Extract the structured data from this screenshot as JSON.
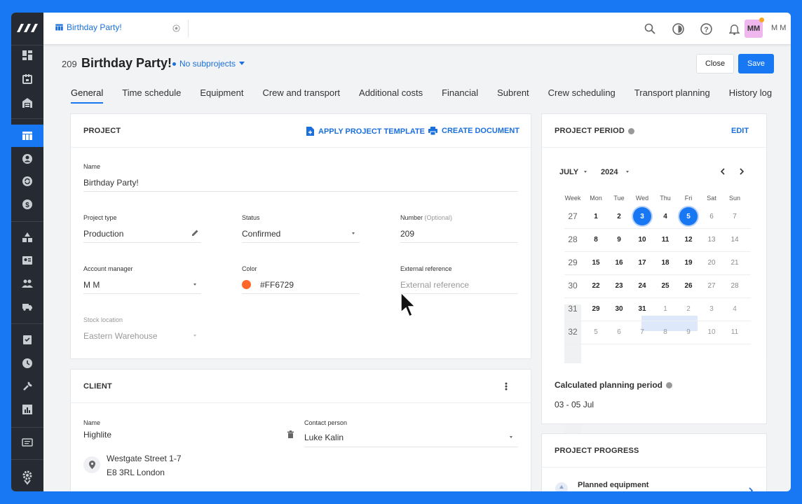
{
  "topbar": {
    "tab_title": "Birthday Party!",
    "user_initials": "MM",
    "user_name": "M M"
  },
  "header": {
    "project_number": "209",
    "project_title": "Birthday Party!",
    "subprojects_label": "No subprojects",
    "close_label": "Close",
    "save_label": "Save"
  },
  "tabs": [
    "General",
    "Time schedule",
    "Equipment",
    "Crew and transport",
    "Additional costs",
    "Financial",
    "Subrent",
    "Crew scheduling",
    "Transport planning",
    "History log"
  ],
  "project_card": {
    "title": "PROJECT",
    "apply_template": "APPLY PROJECT TEMPLATE",
    "create_document": "CREATE DOCUMENT",
    "name_label": "Name",
    "name_value": "Birthday Party!",
    "type_label": "Project type",
    "type_value": "Production",
    "status_label": "Status",
    "status_value": "Confirmed",
    "number_label": "Number",
    "number_optional": "(Optional)",
    "number_value": "209",
    "manager_label": "Account manager",
    "manager_value": "M M",
    "color_label": "Color",
    "color_value": "#FF6729",
    "extref_label": "External reference",
    "extref_placeholder": "External reference",
    "stock_label": "Stock location",
    "stock_value": "Eastern Warehouse"
  },
  "client_card": {
    "title": "CLIENT",
    "name_label": "Name",
    "name_value": "Highlite",
    "contact_label": "Contact person",
    "contact_value": "Luke Kalin",
    "address_line1": "Westgate Street 1-7",
    "address_line2": "E8 3RL London"
  },
  "period_card": {
    "title": "PROJECT PERIOD",
    "edit_label": "EDIT",
    "month": "JULY",
    "year": "2024",
    "week_header": "Week",
    "days": [
      "Mon",
      "Tue",
      "Wed",
      "Thu",
      "Fri",
      "Sat",
      "Sun"
    ],
    "weeks": [
      {
        "week": "27",
        "dates": [
          "1",
          "2",
          "3",
          "4",
          "5",
          "6",
          "7"
        ]
      },
      {
        "week": "28",
        "dates": [
          "8",
          "9",
          "10",
          "11",
          "12",
          "13",
          "14"
        ]
      },
      {
        "week": "29",
        "dates": [
          "15",
          "16",
          "17",
          "18",
          "19",
          "20",
          "21"
        ]
      },
      {
        "week": "30",
        "dates": [
          "22",
          "23",
          "24",
          "25",
          "26",
          "27",
          "28"
        ]
      },
      {
        "week": "31",
        "dates": [
          "29",
          "30",
          "31",
          "1",
          "2",
          "3",
          "4"
        ]
      },
      {
        "week": "32",
        "dates": [
          "5",
          "6",
          "7",
          "8",
          "9",
          "10",
          "11"
        ]
      }
    ],
    "selected_start": "3",
    "selected_end": "5",
    "calc_label": "Calculated planning period",
    "calc_value": "03 - 05 Jul"
  },
  "progress_card": {
    "title": "PROJECT PROGRESS",
    "item1": "Planned equipment"
  },
  "colors": {
    "accent": "#1877f2",
    "sidebar": "#262a33",
    "project_color": "#FF6729"
  }
}
